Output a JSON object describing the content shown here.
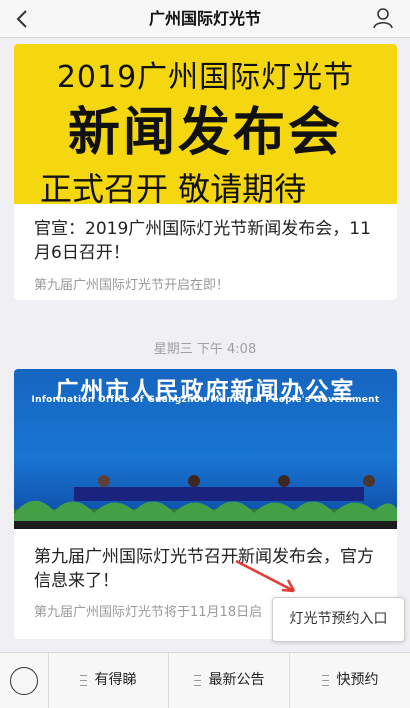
{
  "header": {
    "title": "广州国际灯光节"
  },
  "article1": {
    "banner_line1": "2019广州国际灯光节",
    "banner_line2": "新闻发布会",
    "banner_line3": "正式召开 敬请期待",
    "title": "官宣：2019广州国际灯光节新闻发布会，11月6日召开！",
    "subtitle": "第九届广州国际灯光节开启在即！",
    "banner_color": "#f4d70f"
  },
  "timestamp": "星期三 下午 4:08",
  "article2": {
    "banner_title": "广州市人民政府新闻办公室",
    "banner_subtitle": "Information Office of Guangzhou Municipal People's Government",
    "title": "第九届广州国际灯光节召开新闻发布会，官方信息来了！",
    "subtitle": "第九届广州国际灯光节将于11月18日启"
  },
  "tooltip": {
    "label": "灯光节预约入口"
  },
  "bottom_menu": {
    "items": [
      {
        "label": "有得睇"
      },
      {
        "label": "最新公告"
      },
      {
        "label": "快预约"
      }
    ]
  },
  "colors": {
    "accent_arrow": "#e53935",
    "banner_blue": "#1565c0"
  }
}
